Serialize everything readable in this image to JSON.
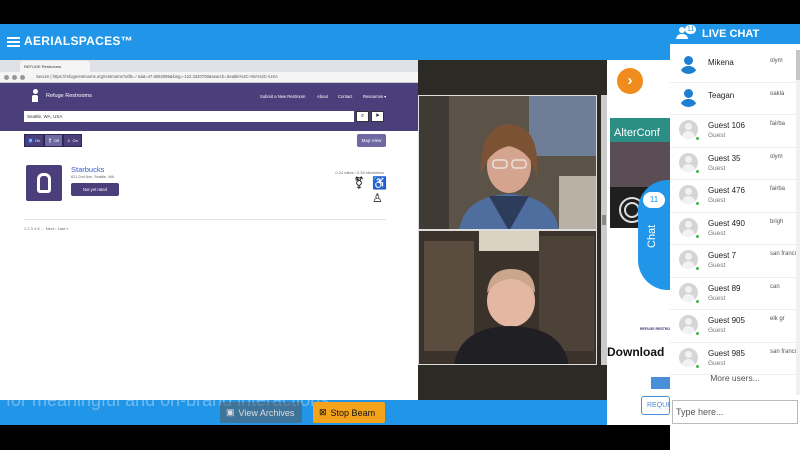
{
  "app": {
    "title": "AERIALSPACES™"
  },
  "browser": {
    "tab_title": "REFUGE Restrooms",
    "url": "Secure | https://refugerestrooms.org/restrooms?utf8=✓&lat=47.6062095&long=-122.3320708&search=Seattle%2C+WA%2C+USA",
    "brand": "Refuge Restrooms",
    "nav": [
      "Submit a New Restroom",
      "About",
      "Contact",
      "Resources ▾"
    ],
    "search_value": "Seattle, WA, USA",
    "toggles": [
      "On",
      "Off",
      "On"
    ],
    "map_view": "Map View",
    "result": {
      "name": "Starbucks",
      "address": "621 2nd Ave, Seattle, WA",
      "rating": "Not yet rated",
      "distance": "0.24 miles / 0.39 kilometers"
    },
    "pager": "1 2 3 4 5 … Next › Last »"
  },
  "stage": {
    "arrow": "›",
    "alterconf": "AlterConf",
    "logo_text": "REFUGE RESTROOMS",
    "download": "Download",
    "request": "REQUE"
  },
  "chat_tab": {
    "label": "Chat",
    "badge": "11"
  },
  "live_chat": {
    "title": "LIVE CHAT",
    "count": "11",
    "users": [
      {
        "name": "Mikena",
        "sub": "",
        "loc": "olym",
        "type": "named"
      },
      {
        "name": "Teagan",
        "sub": "",
        "loc": "oakla",
        "type": "named"
      },
      {
        "name": "Guest 106",
        "sub": "Guest",
        "loc": "fairba",
        "type": "guest"
      },
      {
        "name": "Guest 35",
        "sub": "Guest",
        "loc": "olym",
        "type": "guest"
      },
      {
        "name": "Guest 476",
        "sub": "Guest",
        "loc": "fairba",
        "type": "guest"
      },
      {
        "name": "Guest 490",
        "sub": "Guest",
        "loc": "brigh",
        "type": "guest"
      },
      {
        "name": "Guest 7",
        "sub": "Guest",
        "loc": "san franci",
        "type": "guest"
      },
      {
        "name": "Guest 89",
        "sub": "Guest",
        "loc": "can",
        "type": "guest"
      },
      {
        "name": "Guest 905",
        "sub": "Guest",
        "loc": "elk gr",
        "type": "guest"
      },
      {
        "name": "Guest 985",
        "sub": "Guest",
        "loc": "san franci",
        "type": "guest"
      }
    ],
    "more_users": "More users...",
    "input_placeholder": "Type here..."
  },
  "bottom": {
    "caption": "for meaningful and on-brand interactions",
    "view_archives": "View Archives",
    "stop_beam": "Stop Beam"
  },
  "colors": {
    "primary": "#2196e8",
    "purple": "#4a3f7a",
    "accent": "#f4a31a",
    "online": "#43b649"
  }
}
